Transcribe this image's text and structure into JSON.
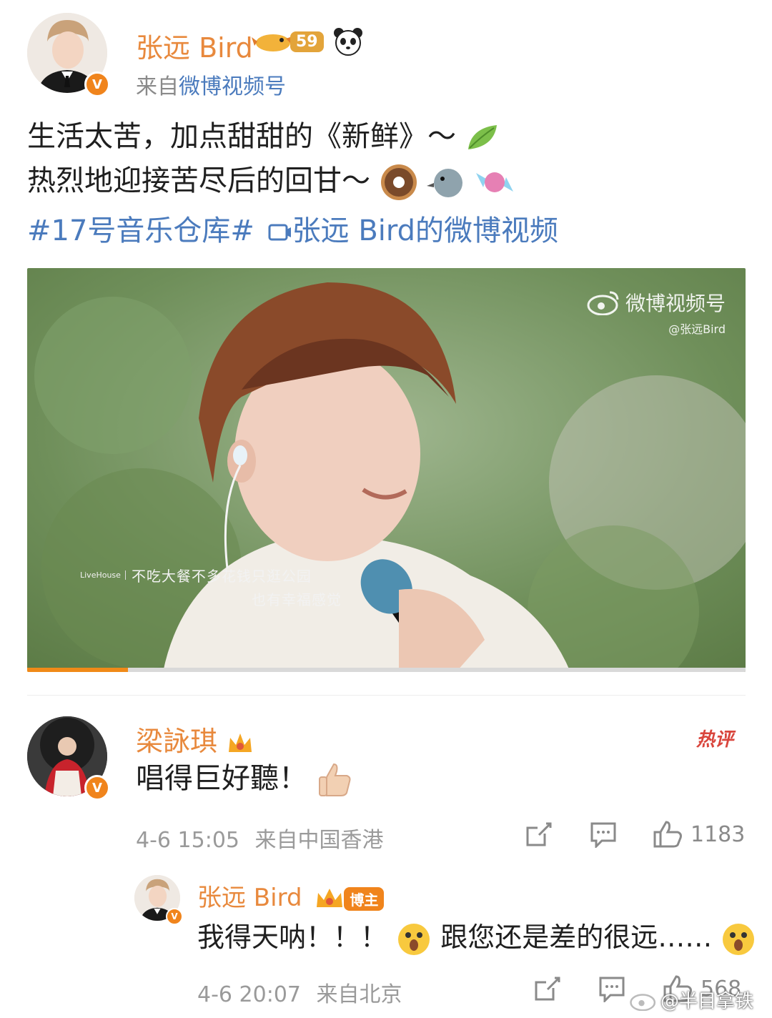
{
  "post": {
    "author": "张远 Bird",
    "level": "59",
    "source_prefix": "来自",
    "source": "微博视频号",
    "line1": "生活太苦，加点甜甜的《新鲜》～",
    "line2": "热烈地迎接苦尽后的回甘～",
    "hashtag": "#17号音乐仓库#",
    "video_link": "张远 Bird的微博视频",
    "icons": [
      "leaf-icon",
      "donut-icon",
      "bird-icon",
      "candy-icon"
    ]
  },
  "video": {
    "watermark": "微博视频号",
    "watermark_handle": "@张远Bird",
    "venue_tag": "LiveHouse",
    "subtitle1": "不吃大餐不多花钱只逛公园",
    "subtitle2": "也有幸福感觉",
    "progress_pct": 14
  },
  "comment": {
    "author": "梁詠琪",
    "hot_label": "热评",
    "text": "唱得巨好聽！",
    "time": "4-6 15:05",
    "location": "来自中国香港",
    "likes": "1183"
  },
  "reply": {
    "author": "张远 Bird",
    "badge_label": "博主",
    "text_part1": "我得天呐！！！",
    "text_part2": "跟您还是差的很远……",
    "time": "4-6 20:07",
    "location": "来自北京",
    "likes": "568"
  },
  "watermark": "@半目拿铁",
  "colors": {
    "name": "#e8893d",
    "link": "#4b7bbd",
    "hot": "#d9453c",
    "verified": "#f0841c"
  }
}
